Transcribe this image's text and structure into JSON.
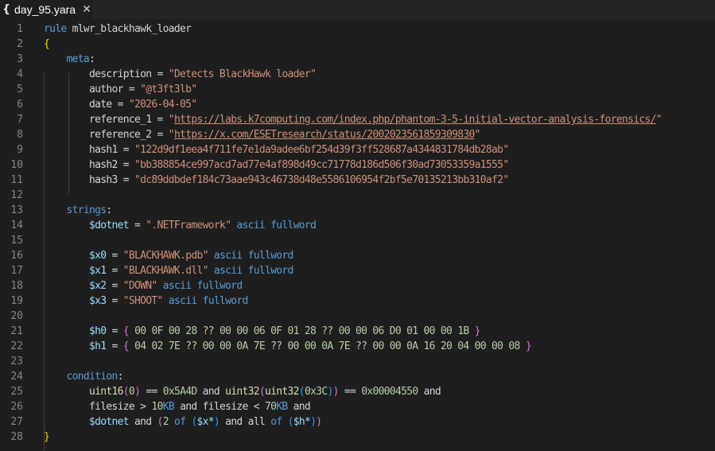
{
  "tab": {
    "icon": "{",
    "title": "day_95.yara",
    "close": "✕"
  },
  "lines": [
    {
      "n": "1",
      "tokens": [
        {
          "t": "rule",
          "c": "kw"
        },
        {
          "t": " mlwr_blackhawk_loader",
          "c": "plain"
        }
      ]
    },
    {
      "n": "2",
      "tokens": [
        {
          "t": "{",
          "c": "br1"
        }
      ]
    },
    {
      "n": "3",
      "tokens": [
        {
          "t": "    ",
          "c": "plain"
        },
        {
          "t": "meta",
          "c": "kw"
        },
        {
          "t": ":",
          "c": "plain"
        }
      ]
    },
    {
      "n": "4",
      "tokens": [
        {
          "t": "        description = ",
          "c": "plain"
        },
        {
          "t": "\"Detects BlackHawk loader\"",
          "c": "str"
        }
      ]
    },
    {
      "n": "5",
      "tokens": [
        {
          "t": "        author = ",
          "c": "plain"
        },
        {
          "t": "\"@t3ft3lb\"",
          "c": "str"
        }
      ]
    },
    {
      "n": "6",
      "tokens": [
        {
          "t": "        date = ",
          "c": "plain"
        },
        {
          "t": "\"2026-04-05\"",
          "c": "str"
        }
      ]
    },
    {
      "n": "7",
      "tokens": [
        {
          "t": "        reference_1 = ",
          "c": "plain"
        },
        {
          "t": "\"",
          "c": "str"
        },
        {
          "t": "https://labs.k7computing.com/index.php/phantom-3-5-initial-vector-analysis-forensics/",
          "c": "url"
        },
        {
          "t": "\"",
          "c": "str"
        }
      ]
    },
    {
      "n": "8",
      "tokens": [
        {
          "t": "        reference_2 = ",
          "c": "plain"
        },
        {
          "t": "\"",
          "c": "str"
        },
        {
          "t": "https://x.com/ESETresearch/status/2002023561859309830",
          "c": "url"
        },
        {
          "t": "\"",
          "c": "str"
        }
      ]
    },
    {
      "n": "9",
      "tokens": [
        {
          "t": "        hash1 = ",
          "c": "plain"
        },
        {
          "t": "\"122d9df1eea4f711fe7e1da9adee6bf254d39f3ff528687a4344831784db28ab\"",
          "c": "str"
        }
      ]
    },
    {
      "n": "10",
      "tokens": [
        {
          "t": "        hash2 = ",
          "c": "plain"
        },
        {
          "t": "\"bb388854ce997acd7ad77e4af898d49cc71778d186d506f30ad73053359a1555\"",
          "c": "str"
        }
      ]
    },
    {
      "n": "11",
      "tokens": [
        {
          "t": "        hash3 = ",
          "c": "plain"
        },
        {
          "t": "\"dc89ddbdef184c73aae943c46738d48e5586106954f2bf5e70135213bb310af2\"",
          "c": "str"
        }
      ]
    },
    {
      "n": "12",
      "tokens": []
    },
    {
      "n": "13",
      "tokens": [
        {
          "t": "    ",
          "c": "plain"
        },
        {
          "t": "strings",
          "c": "kw"
        },
        {
          "t": ":",
          "c": "plain"
        }
      ]
    },
    {
      "n": "14",
      "tokens": [
        {
          "t": "        ",
          "c": "plain"
        },
        {
          "t": "$dotnet",
          "c": "key"
        },
        {
          "t": " = ",
          "c": "plain"
        },
        {
          "t": "\".NETFramework\"",
          "c": "str"
        },
        {
          "t": " ",
          "c": "plain"
        },
        {
          "t": "ascii",
          "c": "kw"
        },
        {
          "t": " ",
          "c": "plain"
        },
        {
          "t": "fullword",
          "c": "kw"
        }
      ]
    },
    {
      "n": "15",
      "tokens": []
    },
    {
      "n": "16",
      "tokens": [
        {
          "t": "        ",
          "c": "plain"
        },
        {
          "t": "$x0",
          "c": "key"
        },
        {
          "t": " = ",
          "c": "plain"
        },
        {
          "t": "\"BLACKHAWK.pdb\"",
          "c": "str"
        },
        {
          "t": " ",
          "c": "plain"
        },
        {
          "t": "ascii",
          "c": "kw"
        },
        {
          "t": " ",
          "c": "plain"
        },
        {
          "t": "fullword",
          "c": "kw"
        }
      ]
    },
    {
      "n": "17",
      "tokens": [
        {
          "t": "        ",
          "c": "plain"
        },
        {
          "t": "$x1",
          "c": "key"
        },
        {
          "t": " = ",
          "c": "plain"
        },
        {
          "t": "\"BLACKHAWK.dll\"",
          "c": "str"
        },
        {
          "t": " ",
          "c": "plain"
        },
        {
          "t": "ascii",
          "c": "kw"
        },
        {
          "t": " ",
          "c": "plain"
        },
        {
          "t": "fullword",
          "c": "kw"
        }
      ]
    },
    {
      "n": "18",
      "tokens": [
        {
          "t": "        ",
          "c": "plain"
        },
        {
          "t": "$x2",
          "c": "key"
        },
        {
          "t": " = ",
          "c": "plain"
        },
        {
          "t": "\"DOWN\"",
          "c": "str"
        },
        {
          "t": " ",
          "c": "plain"
        },
        {
          "t": "ascii",
          "c": "kw"
        },
        {
          "t": " ",
          "c": "plain"
        },
        {
          "t": "fullword",
          "c": "kw"
        }
      ]
    },
    {
      "n": "19",
      "tokens": [
        {
          "t": "        ",
          "c": "plain"
        },
        {
          "t": "$x3",
          "c": "key"
        },
        {
          "t": " = ",
          "c": "plain"
        },
        {
          "t": "\"SHOOT\"",
          "c": "str"
        },
        {
          "t": " ",
          "c": "plain"
        },
        {
          "t": "ascii",
          "c": "kw"
        },
        {
          "t": " ",
          "c": "plain"
        },
        {
          "t": "fullword",
          "c": "kw"
        }
      ]
    },
    {
      "n": "20",
      "tokens": []
    },
    {
      "n": "21",
      "tokens": [
        {
          "t": "        ",
          "c": "plain"
        },
        {
          "t": "$h0",
          "c": "key"
        },
        {
          "t": " = ",
          "c": "plain"
        },
        {
          "t": "{",
          "c": "br2"
        },
        {
          "t": " 00 0F 00 28 ?? 00 00 06 0F 01 28 ?? 00 00 06 D0 01 00 00 1B ",
          "c": "num"
        },
        {
          "t": "}",
          "c": "br2"
        }
      ]
    },
    {
      "n": "22",
      "tokens": [
        {
          "t": "        ",
          "c": "plain"
        },
        {
          "t": "$h1",
          "c": "key"
        },
        {
          "t": " = ",
          "c": "plain"
        },
        {
          "t": "{",
          "c": "br2"
        },
        {
          "t": " 04 02 7E ?? 00 00 0A 7E ?? 00 00 0A 7E ?? 00 00 0A 16 20 04 00 00 08 ",
          "c": "num"
        },
        {
          "t": "}",
          "c": "br2"
        }
      ]
    },
    {
      "n": "23",
      "tokens": []
    },
    {
      "n": "24",
      "tokens": [
        {
          "t": "    ",
          "c": "plain"
        },
        {
          "t": "condition",
          "c": "kw"
        },
        {
          "t": ":",
          "c": "plain"
        }
      ]
    },
    {
      "n": "25",
      "tokens": [
        {
          "t": "        ",
          "c": "plain"
        },
        {
          "t": "uint16",
          "c": "fn"
        },
        {
          "t": "(",
          "c": "br2"
        },
        {
          "t": "0",
          "c": "num"
        },
        {
          "t": ")",
          "c": "br2"
        },
        {
          "t": " == ",
          "c": "plain"
        },
        {
          "t": "0x5A4D",
          "c": "num"
        },
        {
          "t": " and ",
          "c": "plain"
        },
        {
          "t": "uint32",
          "c": "fn"
        },
        {
          "t": "(",
          "c": "br2"
        },
        {
          "t": "uint32",
          "c": "fn"
        },
        {
          "t": "(",
          "c": "br3"
        },
        {
          "t": "0x3C",
          "c": "num"
        },
        {
          "t": ")",
          "c": "br3"
        },
        {
          "t": ")",
          "c": "br2"
        },
        {
          "t": " == ",
          "c": "plain"
        },
        {
          "t": "0x00004550",
          "c": "num"
        },
        {
          "t": " and",
          "c": "plain"
        }
      ]
    },
    {
      "n": "26",
      "tokens": [
        {
          "t": "        filesize > ",
          "c": "plain"
        },
        {
          "t": "10",
          "c": "num"
        },
        {
          "t": "KB",
          "c": "kw"
        },
        {
          "t": " and filesize < ",
          "c": "plain"
        },
        {
          "t": "70",
          "c": "num"
        },
        {
          "t": "KB",
          "c": "kw"
        },
        {
          "t": " and",
          "c": "plain"
        }
      ]
    },
    {
      "n": "27",
      "tokens": [
        {
          "t": "        ",
          "c": "plain"
        },
        {
          "t": "$dotnet",
          "c": "key"
        },
        {
          "t": " and ",
          "c": "plain"
        },
        {
          "t": "(",
          "c": "br2"
        },
        {
          "t": "2",
          "c": "num"
        },
        {
          "t": " ",
          "c": "plain"
        },
        {
          "t": "of",
          "c": "kw"
        },
        {
          "t": " ",
          "c": "plain"
        },
        {
          "t": "(",
          "c": "br3"
        },
        {
          "t": "$x*",
          "c": "key"
        },
        {
          "t": ")",
          "c": "br3"
        },
        {
          "t": " and all ",
          "c": "plain"
        },
        {
          "t": "of",
          "c": "kw"
        },
        {
          "t": " ",
          "c": "plain"
        },
        {
          "t": "(",
          "c": "br3"
        },
        {
          "t": "$h*",
          "c": "key"
        },
        {
          "t": ")",
          "c": "br3"
        },
        {
          "t": ")",
          "c": "br2"
        }
      ]
    },
    {
      "n": "28",
      "tokens": [
        {
          "t": "}",
          "c": "br1"
        }
      ]
    }
  ]
}
